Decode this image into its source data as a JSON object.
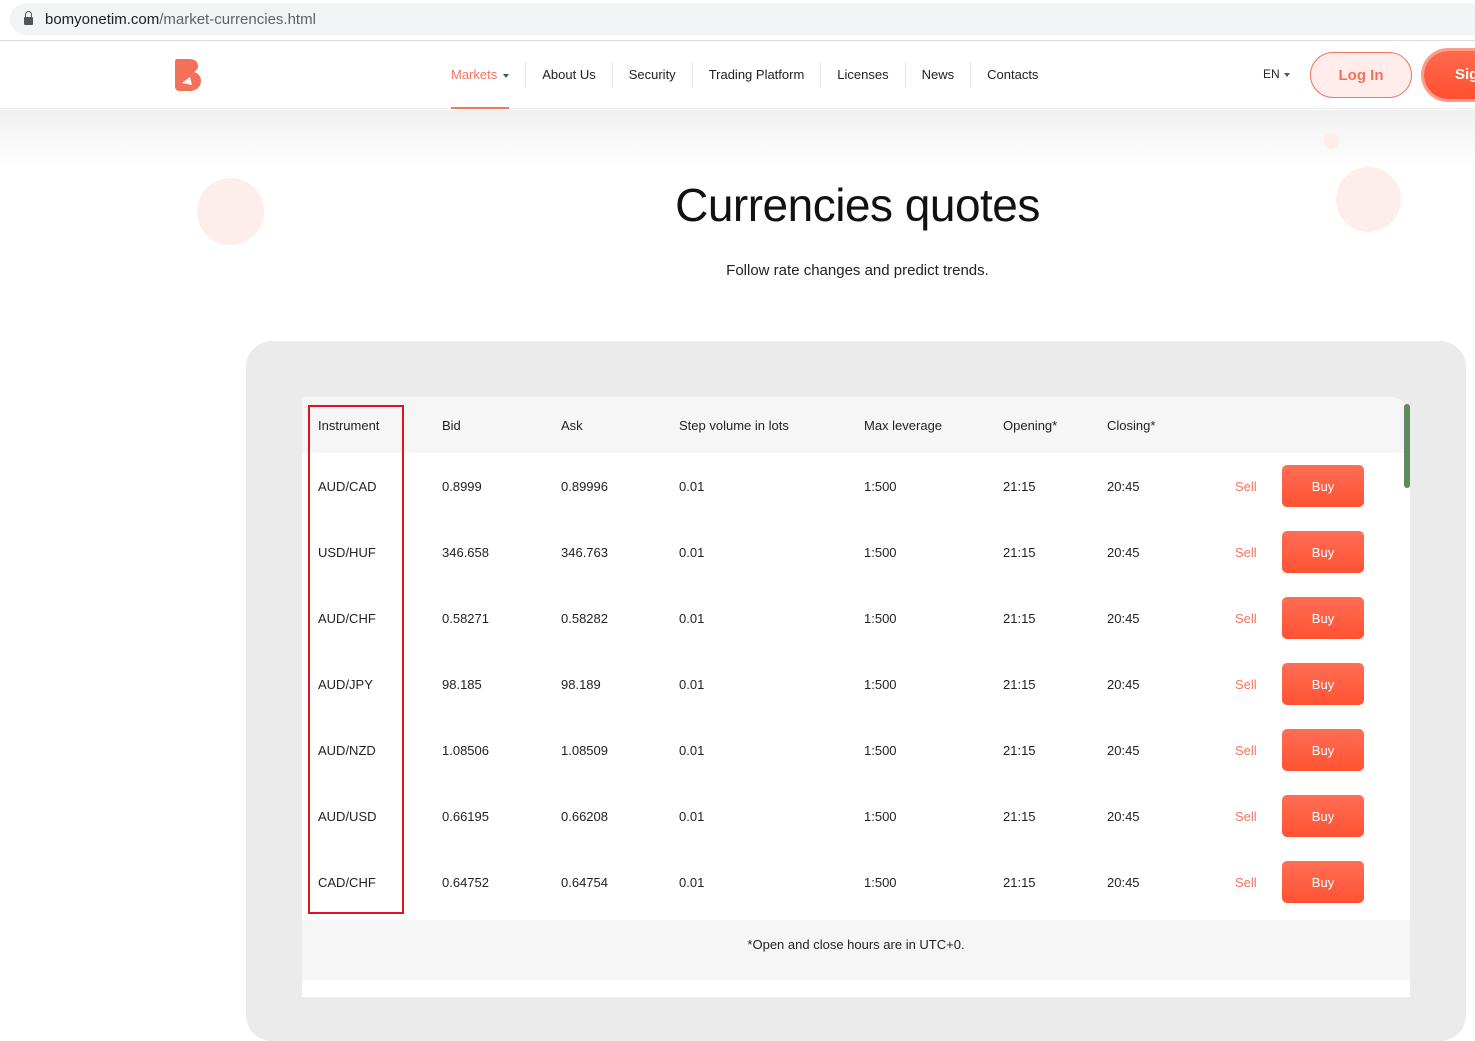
{
  "browser": {
    "url_host": "bomyonetim.com",
    "url_path": "/market-currencies.html"
  },
  "nav": {
    "items": [
      {
        "label": "Markets"
      },
      {
        "label": "About Us"
      },
      {
        "label": "Security"
      },
      {
        "label": "Trading Platform"
      },
      {
        "label": "Licenses"
      },
      {
        "label": "News"
      },
      {
        "label": "Contacts"
      }
    ],
    "language": "EN",
    "login": "Log In",
    "signup": "Sig"
  },
  "hero": {
    "title": "Currencies quotes",
    "subtitle": "Follow rate changes and predict trends."
  },
  "table": {
    "headers": [
      "Instrument",
      "Bid",
      "Ask",
      "Step volume in lots",
      "Max leverage",
      "Opening*",
      "Closing*"
    ],
    "rows": [
      [
        "AUD/CAD",
        "0.8999",
        "0.89996",
        "0.01",
        "1:500",
        "21:15",
        "20:45"
      ],
      [
        "USD/HUF",
        "346.658",
        "346.763",
        "0.01",
        "1:500",
        "21:15",
        "20:45"
      ],
      [
        "AUD/CHF",
        "0.58271",
        "0.58282",
        "0.01",
        "1:500",
        "21:15",
        "20:45"
      ],
      [
        "AUD/JPY",
        "98.185",
        "98.189",
        "0.01",
        "1:500",
        "21:15",
        "20:45"
      ],
      [
        "AUD/NZD",
        "1.08506",
        "1.08509",
        "0.01",
        "1:500",
        "21:15",
        "20:45"
      ],
      [
        "AUD/USD",
        "0.66195",
        "0.66208",
        "0.01",
        "1:500",
        "21:15",
        "20:45"
      ],
      [
        "CAD/CHF",
        "0.64752",
        "0.64754",
        "0.01",
        "1:500",
        "21:15",
        "20:45"
      ]
    ],
    "sell_label": "Sell",
    "buy_label": "Buy",
    "footnote": "*Open and close hours are in UTC+0."
  },
  "colors": {
    "accent": "#f47560",
    "buy": "#ff5a3c"
  }
}
